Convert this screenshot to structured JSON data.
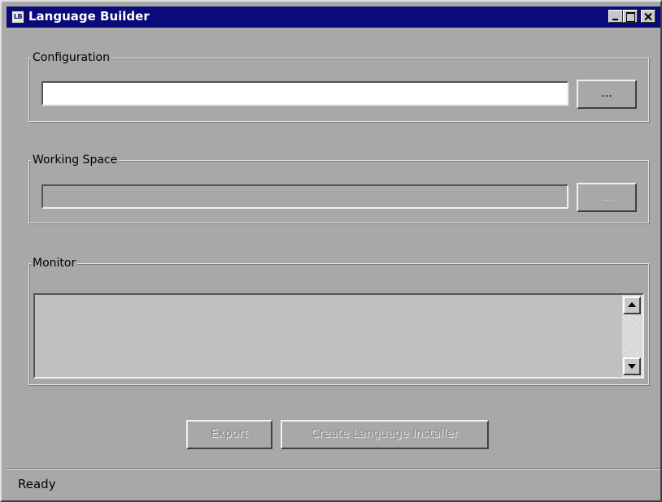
{
  "window": {
    "title": "Language Builder",
    "icon_text": "LB",
    "controls": [
      "minimize-icon",
      "maximize-icon",
      "close-icon"
    ]
  },
  "configuration": {
    "label": "Configuration",
    "path_value": "",
    "browse_label": "..."
  },
  "working_space": {
    "label": "Working Space",
    "path_value": "",
    "browse_label": "..."
  },
  "monitor": {
    "label": "Monitor",
    "log_text": ""
  },
  "actions": {
    "export_label": "Export",
    "create_installer_label": "Create Language Installer"
  },
  "status_bar": {
    "text": "Ready"
  },
  "colors": {
    "titlebar": "#0a0a7a",
    "window_bg": "#a8a8a8"
  }
}
